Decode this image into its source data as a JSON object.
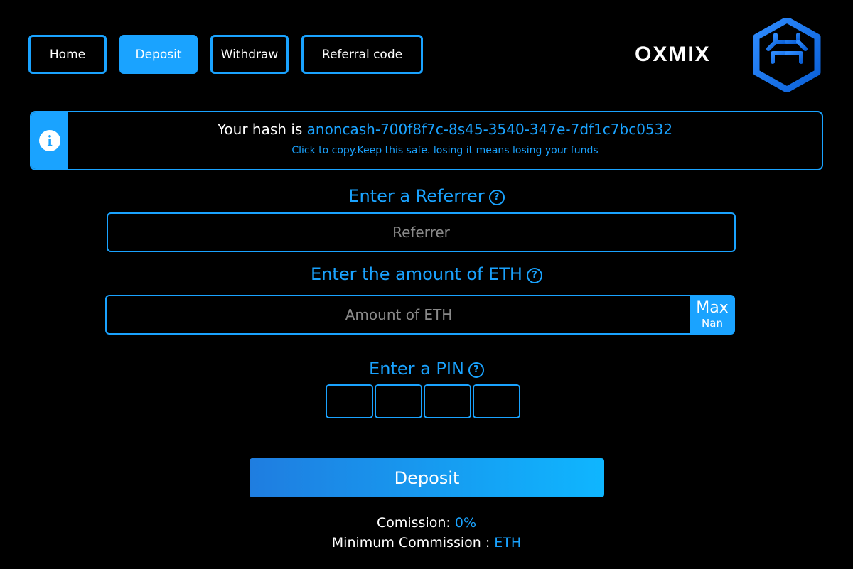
{
  "nav": {
    "home": "Home",
    "deposit": "Deposit",
    "withdraw": "Withdraw",
    "referral": "Referral  code"
  },
  "brand": {
    "name": "OXMIX",
    "logo_icon": "brain-hex-icon"
  },
  "hash_banner": {
    "prefix": "Your hash is ",
    "hash": "anoncash-700f8f7c-8s45-3540-347e-7df1c7bc0532",
    "note": "Click to copy.Keep this safe. losing it means losing your funds",
    "icon": "info-icon"
  },
  "referrer": {
    "label": "Enter a Referrer",
    "placeholder": "Referrer",
    "help": "?"
  },
  "amount": {
    "label": "Enter the amount of ETH",
    "placeholder": "Amount of ETH",
    "help": "?",
    "max_label": "Max",
    "max_value": "Nan"
  },
  "pin": {
    "label": "Enter a PIN",
    "help": "?"
  },
  "deposit_button": "Deposit",
  "commission": {
    "label": "Comission: ",
    "value": "0%",
    "min_label": "Minimum Commission : ",
    "min_value": "ETH"
  },
  "colors": {
    "accent": "#1aa3ff",
    "background": "#000000"
  }
}
